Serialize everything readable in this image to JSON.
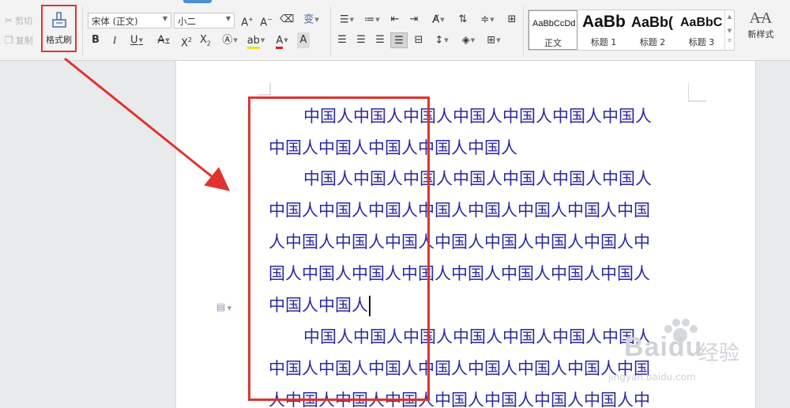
{
  "toolbar": {
    "cut_label": "剪切",
    "copy_label": "复制",
    "format_painter_label": "格式刷",
    "font_family": "宋体 (正文)",
    "font_size": "小二",
    "styles": [
      {
        "preview": "AaBbCcDd",
        "name": "正文"
      },
      {
        "preview": "AaBb",
        "name": "标题 1"
      },
      {
        "preview": "AaBb(",
        "name": "标题 2"
      },
      {
        "preview": "AaBbC",
        "name": "标题 3"
      }
    ],
    "new_style_label": "新样式"
  },
  "document": {
    "lines": [
      "中国人中国人中国人中国人中国人中国人中国人",
      "中国人中国人中国人中国人中国人",
      "中国人中国人中国人中国人中国人中国人中国人",
      "中国人中国人中国人中国人中国人中国人中国人中国",
      "人中国人中国人中国人中国人中国人中国人中国人中",
      "国人中国人中国人中国人中国人中国人中国人中国人",
      "中国人中国人",
      "中国人中国人中国人中国人中国人中国人中国人",
      "中国人中国人中国人中国人中国人中国人中国人中国",
      "人中国人中国人中国人中国人中国人中国人中国人中"
    ]
  },
  "watermark": {
    "brand": "Baidu",
    "brand_cn": "经验",
    "url": "jingyan.baidu.com"
  },
  "colors": {
    "highlight_red": "#e0332f",
    "text_blue": "#2d2aa0"
  }
}
